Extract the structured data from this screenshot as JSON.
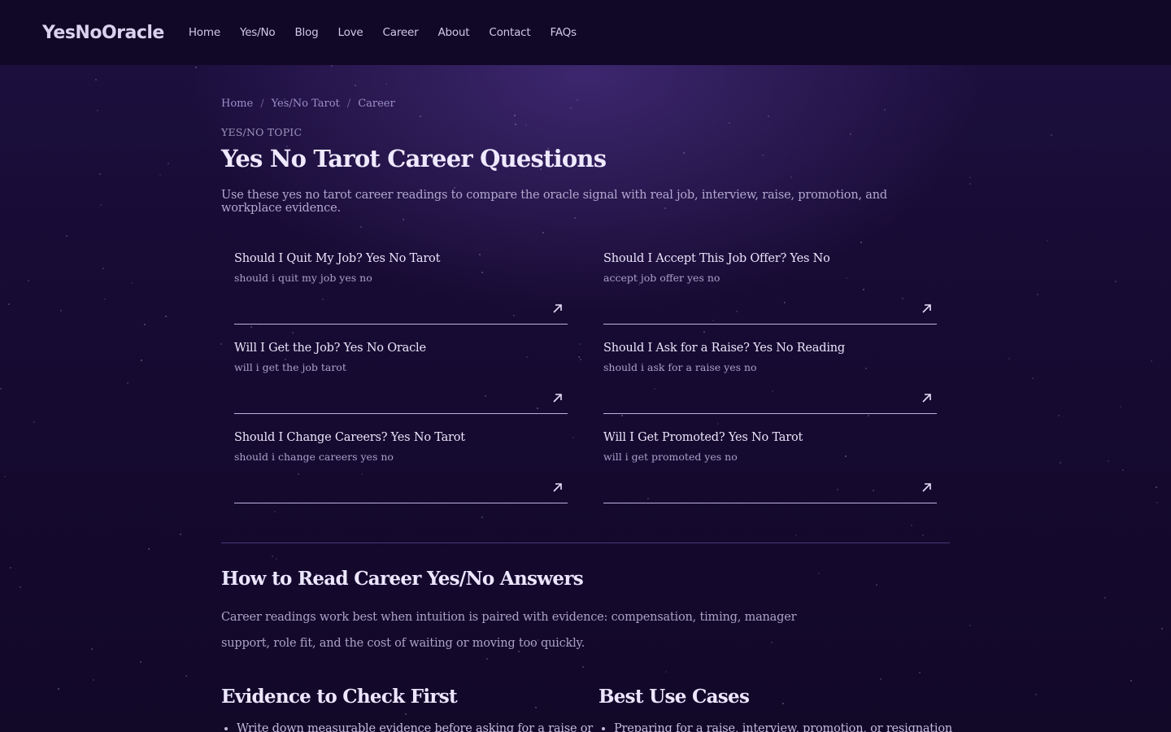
{
  "header": {
    "logo": "YesNoOracle",
    "nav": [
      "Home",
      "Yes/No",
      "Blog",
      "Love",
      "Career",
      "About",
      "Contact",
      "FAQs"
    ]
  },
  "breadcrumb": [
    "Home",
    "Yes/No Tarot",
    "Career"
  ],
  "page": {
    "eyebrow": "Yes/No Topic",
    "title": "Yes No Tarot Career Questions",
    "lead": "Use these yes no tarot career readings to compare the oracle signal with real job, interview, raise, promotion, and workplace evidence."
  },
  "cards": [
    {
      "title": "Should I Quit My Job? Yes No Tarot",
      "sub": "should i quit my job yes no"
    },
    {
      "title": "Should I Accept This Job Offer? Yes No",
      "sub": "accept job offer yes no"
    },
    {
      "title": "Will I Get the Job? Yes No Oracle",
      "sub": "will i get the job tarot"
    },
    {
      "title": "Should I Ask for a Raise? Yes No Reading",
      "sub": "should i ask for a raise yes no"
    },
    {
      "title": "Should I Change Careers? Yes No Tarot",
      "sub": "should i change careers yes no"
    },
    {
      "title": "Will I Get Promoted? Yes No Tarot",
      "sub": "will i get promoted yes no"
    }
  ],
  "how_to": {
    "heading": "How to Read Career Yes/No Answers",
    "body": "Career readings work best when intuition is paired with evidence: compensation, timing, manager support, role fit, and the cost of waiting or moving too quickly."
  },
  "evidence": {
    "heading": "Evidence to Check First",
    "items": [
      "Write down measurable evidence before asking for a raise or"
    ]
  },
  "use_cases": {
    "heading": "Best Use Cases",
    "items": [
      "Preparing for a raise, interview, promotion, or resignation"
    ]
  },
  "icons": {
    "card_arrow": "arrow-up-right-icon"
  },
  "colors": {
    "background": "#14092b",
    "header": "#110726",
    "accent": "#9b8fc9"
  }
}
